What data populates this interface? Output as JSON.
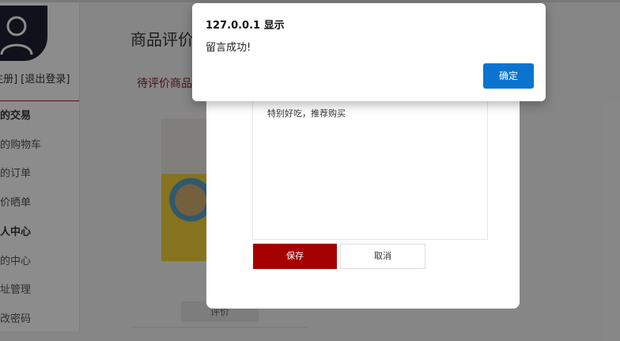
{
  "browser_alert": {
    "title": "127.0.0.1 显示",
    "message": "留言成功!",
    "ok_label": "确定"
  },
  "sidebar": {
    "user_links": "[注册]  [退出登录]",
    "items": [
      {
        "label": "我的交易",
        "heading": true
      },
      {
        "label": "我的购物车"
      },
      {
        "label": "我的订单"
      },
      {
        "label": "评价晒单"
      },
      {
        "label": "个人中心",
        "heading": true
      },
      {
        "label": "我的中心"
      },
      {
        "label": "地址管理"
      },
      {
        "label": "修改密码"
      }
    ]
  },
  "main": {
    "title": "商品评价",
    "tab_label": "待评价商品",
    "review_button_label": "评价"
  },
  "modal": {
    "comment_text": "特别好吃，推荐购买",
    "save_label": "保存",
    "cancel_label": "取消"
  },
  "colors": {
    "accent_red": "#a50000",
    "ok_blue": "#0b74d0"
  }
}
